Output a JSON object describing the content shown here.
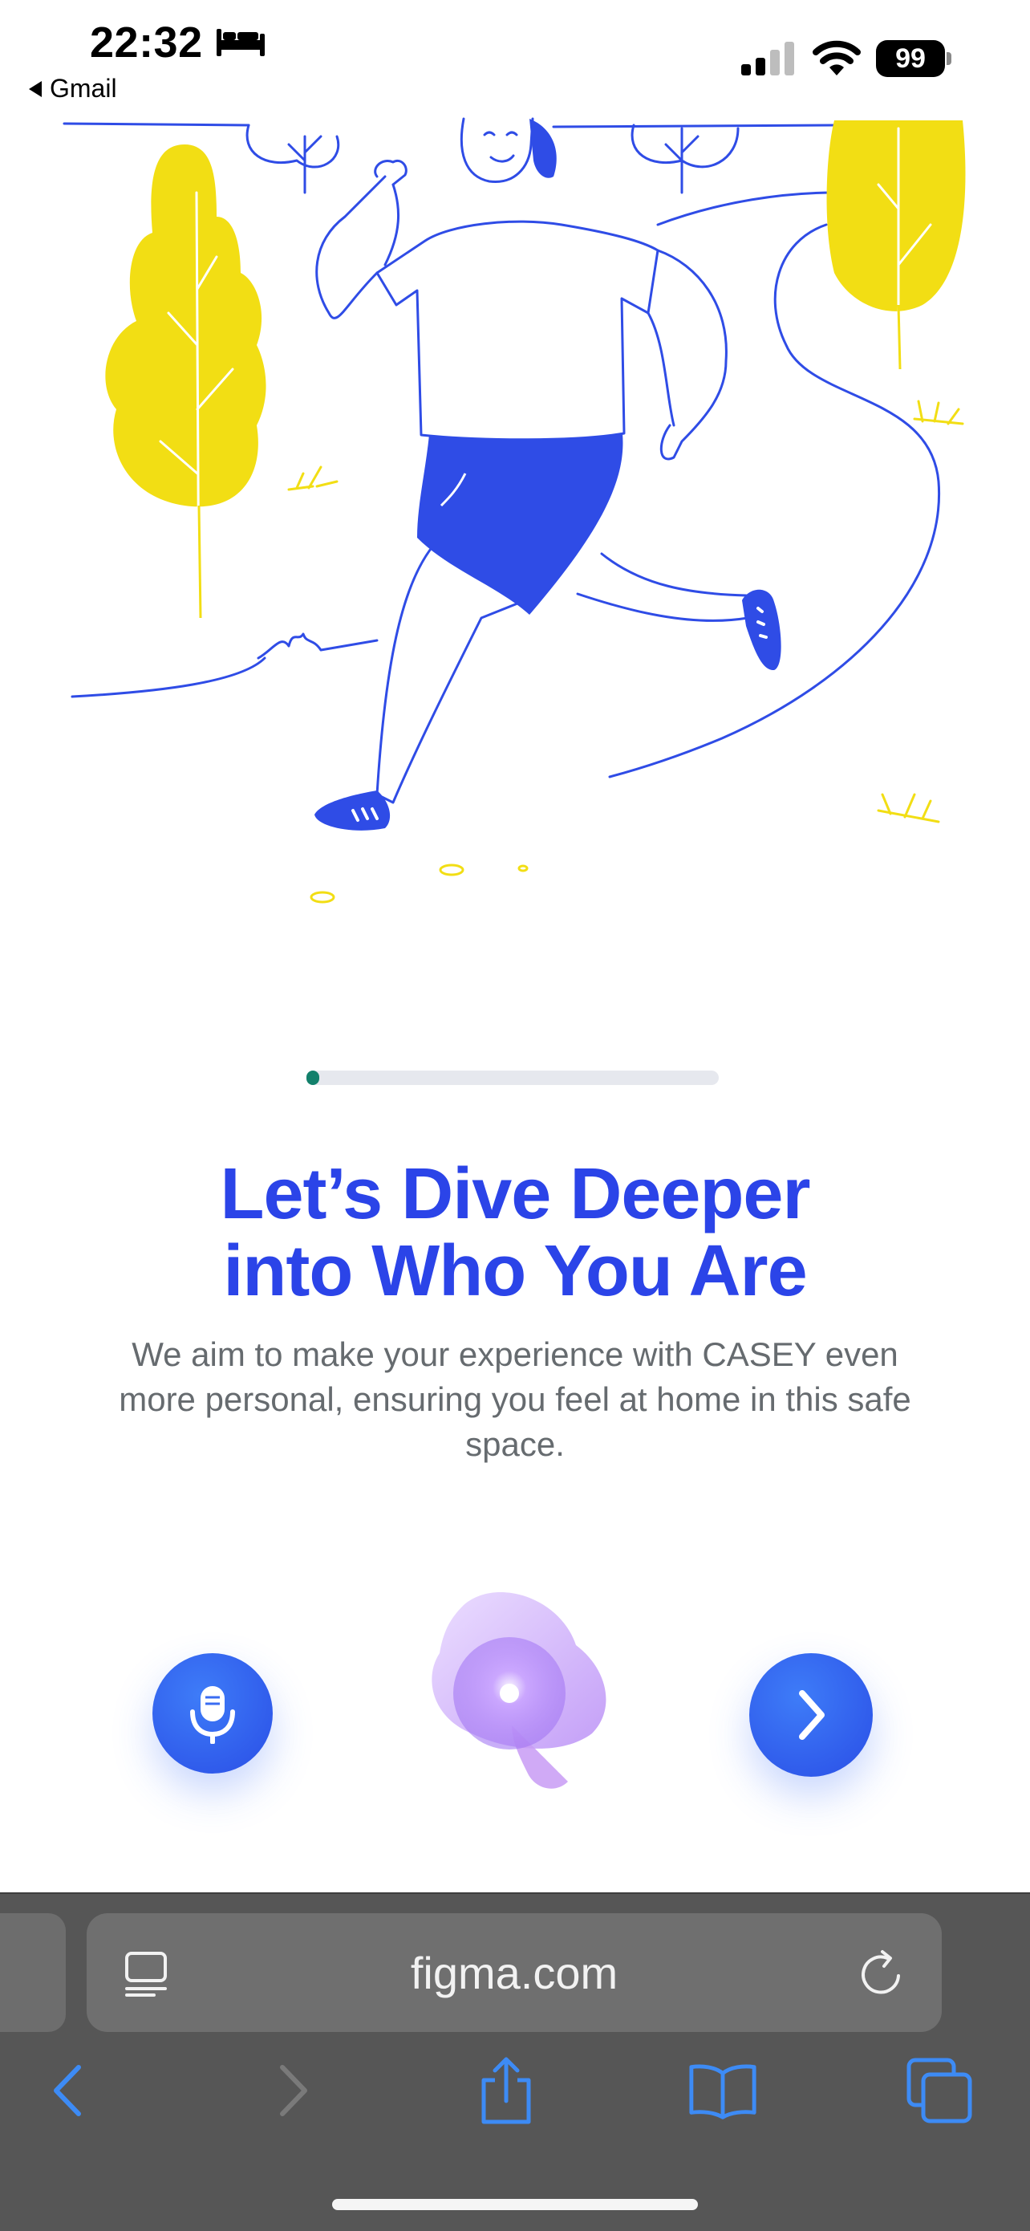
{
  "status_bar": {
    "time": "22:32",
    "back_app": "Gmail",
    "battery": "99"
  },
  "onboarding": {
    "progress": 0.03,
    "title_line1": "Let’s Dive Deeper",
    "title_line2": "into Who You Are",
    "subtitle": "We aim to make your experience with CASEY even more personal, ensuring you feel at home in this safe space."
  },
  "colors": {
    "accent": "#2b44e8",
    "illustration_line": "#2f4ce6",
    "tree_yellow": "#f2de14",
    "progress": "#12806b"
  },
  "safari": {
    "url": "figma.com"
  },
  "icons": [
    "bed-icon",
    "signal-icon",
    "wifi-icon",
    "microphone-icon",
    "chevron-right-icon",
    "reader-icon",
    "reload-icon",
    "back-icon",
    "forward-icon",
    "share-icon",
    "bookmarks-icon",
    "tabs-icon"
  ]
}
